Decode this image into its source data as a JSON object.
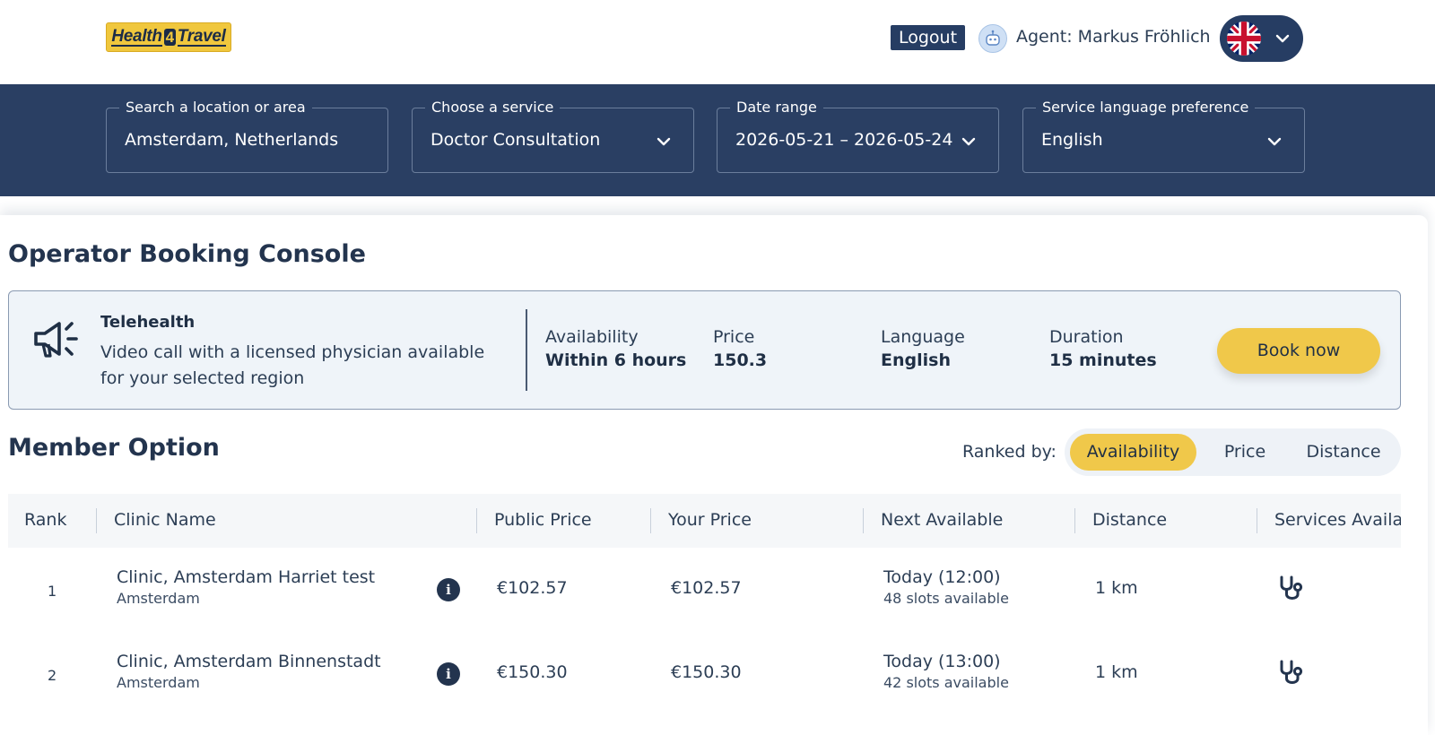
{
  "header": {
    "logo": {
      "left": "Health",
      "num": "4",
      "right": "Travel"
    },
    "logout_label": "Logout",
    "agent_label": "Agent: Markus Fröhlich",
    "language_flag": "uk-flag-icon"
  },
  "search": {
    "location": {
      "label": "Search a location or area",
      "value": "Amsterdam, Netherlands"
    },
    "service": {
      "label": "Choose a service",
      "value": "Doctor Consultation"
    },
    "date": {
      "label": "Date range",
      "value": "2026-05-21 – 2026-05-24"
    },
    "language": {
      "label": "Service language preference",
      "value": "English"
    }
  },
  "page_title": "Operator Booking Console",
  "promo": {
    "icon": "megaphone-icon",
    "title": "Telehealth",
    "description": "Video call with a licensed physician available for your selected region",
    "stats": [
      {
        "label": "Availability",
        "value": "Within 6 hours"
      },
      {
        "label": "Price",
        "value": "150.3"
      },
      {
        "label": "Language",
        "value": "English"
      },
      {
        "label": "Duration",
        "value": "15 minutes"
      }
    ],
    "book_label": "Book now"
  },
  "section_title": "Member Option",
  "ranking": {
    "label": "Ranked by:",
    "options": [
      "Availability",
      "Price",
      "Distance"
    ],
    "active": "Availability"
  },
  "table": {
    "columns": [
      "Rank",
      "Clinic Name",
      "Public Price",
      "Your Price",
      "Next Available",
      "Distance",
      "Services Availabl"
    ],
    "rows": [
      {
        "rank": "1",
        "clinic": "Clinic, Amsterdam Harriet test",
        "city": "Amsterdam",
        "public_price": "€102.57",
        "your_price": "€102.57",
        "next_time": "Today (12:00)",
        "slots": "48 slots available",
        "distance": "1 km",
        "service_icon": "stethoscope-icon"
      },
      {
        "rank": "2",
        "clinic": "Clinic, Amsterdam Binnenstadt",
        "city": "Amsterdam",
        "public_price": "€150.30",
        "your_price": "€150.30",
        "next_time": "Today (13:00)",
        "slots": "42 slots available",
        "distance": "1 km",
        "service_icon": "stethoscope-icon"
      }
    ]
  }
}
